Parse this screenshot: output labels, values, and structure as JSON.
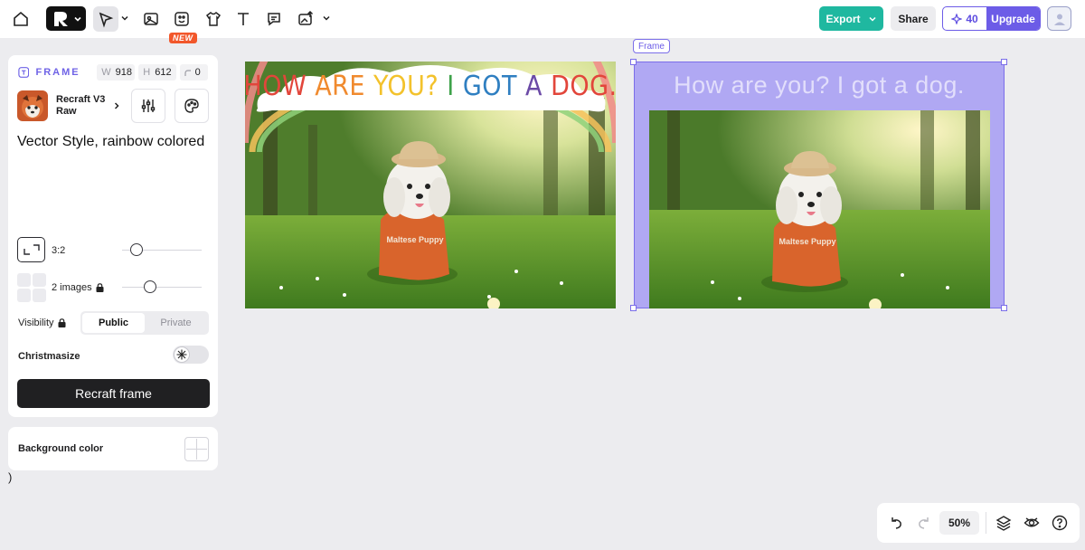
{
  "toolbar": {
    "new_badge": "NEW",
    "export_label": "Export",
    "share_label": "Share",
    "credits": "40",
    "upgrade_label": "Upgrade"
  },
  "panel": {
    "frame_label": "FRAME",
    "width_key": "W",
    "width_value": "918",
    "height_key": "H",
    "height_value": "612",
    "radius_value": "0",
    "model_name": "Recraft V3 Raw",
    "prompt": "Vector Style, rainbow colored",
    "aspect_ratio": "3:2",
    "aspect_slider_fraction": 0.18,
    "images_label": "2 images",
    "images_slider_fraction": 0.35,
    "visibility_label": "Visibility",
    "visibility_options": [
      "Public",
      "Private"
    ],
    "visibility_selected": "Public",
    "christmasize_label": "Christmasize",
    "recraft_button": "Recraft frame",
    "background_label": "Background color",
    "stray_text": ")"
  },
  "canvas": {
    "frame_tag": "Frame",
    "image1_title": "HOW ARE YOU? I GOT A DOG.",
    "image1_title_colors": [
      "#e2463b",
      "#f08a2e",
      "#f3c22c",
      "#3ea24a",
      "#2f7fc1",
      "#6b4aa6"
    ],
    "frame2_title": "How are you? I got a dog.",
    "shirt_text": "Maltese Puppy"
  },
  "bottombar": {
    "zoom": "50%"
  },
  "colors": {
    "accent": "#6c5ce7",
    "export": "#1fb8a0",
    "new_badge": "#f2572b"
  }
}
